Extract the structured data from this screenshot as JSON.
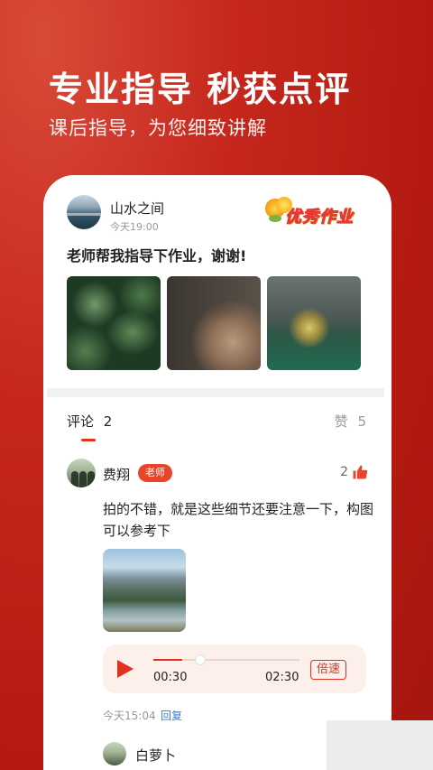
{
  "hero": {
    "title": "专业指导 秒获点评",
    "subtitle": "课后指导，为您细致讲解"
  },
  "post": {
    "username": "山水之间",
    "time": "今天19:00",
    "badge_text": "优秀作业",
    "text": "老师帮我指导下作业，谢谢!",
    "photos": [
      "plant-leaves-photo",
      "hands-soil-photo",
      "lake-island-photo"
    ]
  },
  "tabs": {
    "comments_label": "评论",
    "comments_count": "2",
    "likes_label": "赞",
    "likes_count": "5"
  },
  "comment1": {
    "name": "费翔",
    "role_badge": "老师",
    "likes": "2",
    "text": "拍的不错，就是这些细节还要注意一下，构图可以参考下",
    "audio": {
      "current_time": "00:30",
      "total_time": "02:30",
      "progress": 0.2,
      "speed_label": "倍速"
    },
    "time": "今天15:04",
    "reply_label": "回复"
  },
  "comment2": {
    "name": "白萝卜"
  },
  "colors": {
    "accent": "#e0321f",
    "background_red": "#c5271d",
    "link_blue": "#3a7ad1"
  }
}
